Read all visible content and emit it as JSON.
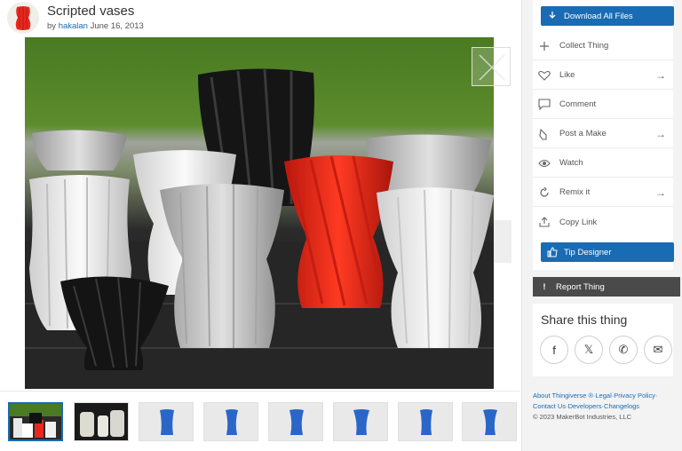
{
  "thing": {
    "title": "Scripted vases",
    "by_prefix": "by",
    "author": "hakalan",
    "date": "June 16, 2013"
  },
  "icons": {
    "avatar": "red-vase-avatar",
    "zoom": "expand-icon",
    "download": "download-arrow-icon",
    "collect": "plus-icon",
    "like": "heart-icon",
    "comment": "comment-bubble-icon",
    "post_make": "hand-pointer-icon",
    "watch": "eye-icon",
    "remix": "remix-icon",
    "copy_link": "share-upload-icon",
    "tip": "thumbs-up-icon",
    "report": "exclamation-icon",
    "arrow": "arrow-right-icon"
  },
  "sidebar": {
    "download_label": "Download All Files",
    "actions": [
      {
        "label": "Collect Thing",
        "has_arrow": false
      },
      {
        "label": "Like",
        "has_arrow": true
      },
      {
        "label": "Comment",
        "has_arrow": false
      },
      {
        "label": "Post a Make",
        "has_arrow": true
      },
      {
        "label": "Watch",
        "has_arrow": false
      },
      {
        "label": "Remix it",
        "has_arrow": true
      },
      {
        "label": "Copy Link",
        "has_arrow": false
      }
    ],
    "tip_label": "Tip Designer",
    "report_label": "Report Thing",
    "share_title": "Share this thing",
    "share_icons": [
      "f",
      "𝕏",
      "✆",
      "✉"
    ]
  },
  "thumbnails": {
    "count": 8,
    "active_index": 0
  },
  "footer": {
    "links_line1": "About Thingiverse ®·Legal·Privacy Policy·",
    "links_line2": "Contact Us·Developers·Changelogs",
    "copyright": "© 2023 MakerBot Industries, LLC"
  },
  "colors": {
    "accent": "#196bb3",
    "report": "#4a4a4a",
    "vase_red": "#e8281d",
    "vase_white": "#efefef",
    "vase_black": "#1a1a1a",
    "thumb_blue": "#2a66c8"
  }
}
